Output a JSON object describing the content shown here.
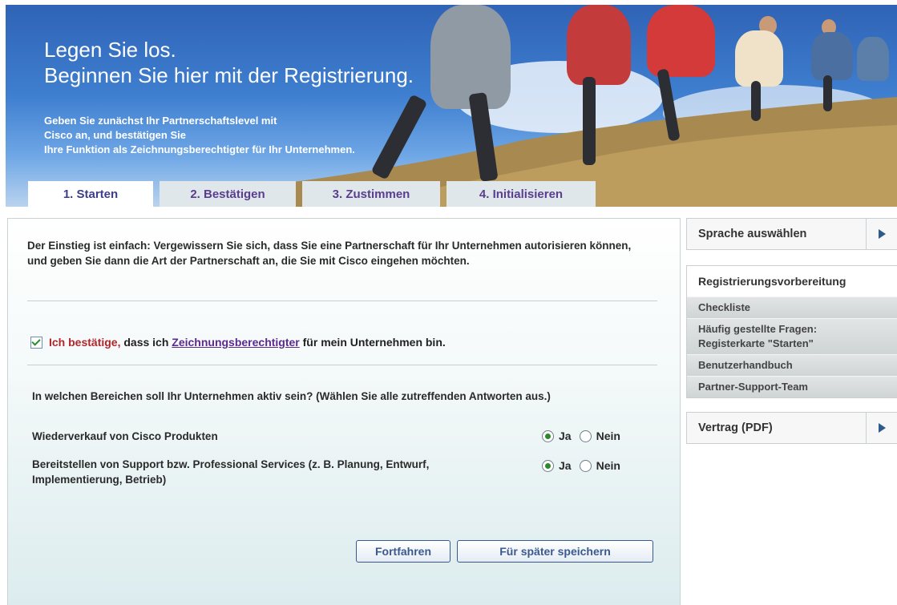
{
  "banner": {
    "title_line1": "Legen Sie los.",
    "title_line2": "Beginnen Sie hier mit der Registrierung.",
    "sub_line1": "Geben Sie zunächst Ihr Partnerschaftslevel mit",
    "sub_line2": "Cisco an, und bestätigen Sie",
    "sub_line3": "Ihre Funktion als Zeichnungsberechtigter für Ihr Unternehmen."
  },
  "tabs": [
    {
      "label": "1. Starten",
      "active": true
    },
    {
      "label": "2. Bestätigen",
      "active": false
    },
    {
      "label": "3. Zustimmen",
      "active": false
    },
    {
      "label": "4. Initialisieren",
      "active": false
    }
  ],
  "main": {
    "intro": "Der Einstieg ist einfach: Vergewissern Sie sich, dass Sie eine Partnerschaft für Ihr Unternehmen autorisieren können, und geben Sie dann die Art der Partnerschaft an, die Sie mit Cisco eingehen möchten.",
    "confirm": {
      "checked": true,
      "red_text": "Ich bestätige,",
      "text_before_link": " dass ich ",
      "link_text": "Zeichnungsberechtigter",
      "text_after_link": " für mein Unternehmen bin."
    },
    "question": "In welchen Bereichen soll Ihr Unternehmen aktiv sein? (Wählen Sie alle zutreffenden Antworten aus.)",
    "rows": [
      {
        "label": "Wiederverkauf von Cisco Produkten",
        "yes": "Ja",
        "no": "Nein",
        "selected": "Ja"
      },
      {
        "label": "Bereitstellen von Support bzw. Professional Services (z. B. Planung, Entwurf, Implementierung, Betrieb)",
        "yes": "Ja",
        "no": "Nein",
        "selected": "Ja"
      }
    ],
    "buttons": {
      "continue": "Fortfahren",
      "save_later": "Für später speichern"
    }
  },
  "sidebar": {
    "language": "Sprache auswählen",
    "prep_title": "Registrierungsvorbereitung",
    "links": [
      "Checkliste",
      "Häufig gestellte Fragen: Registerkarte \"Starten\"",
      "Benutzerhandbuch",
      "Partner-Support-Team"
    ],
    "contract": "Vertrag (PDF)"
  },
  "colors": {
    "accent": "#5b3d8f",
    "confirm_red": "#b0262a",
    "radio_green": "#2c8a2c",
    "button_border": "#37598f"
  },
  "icons": [
    "checkbox-checked-icon",
    "radio-selected-icon",
    "radio-unselected-icon",
    "arrow-right-icon"
  ]
}
